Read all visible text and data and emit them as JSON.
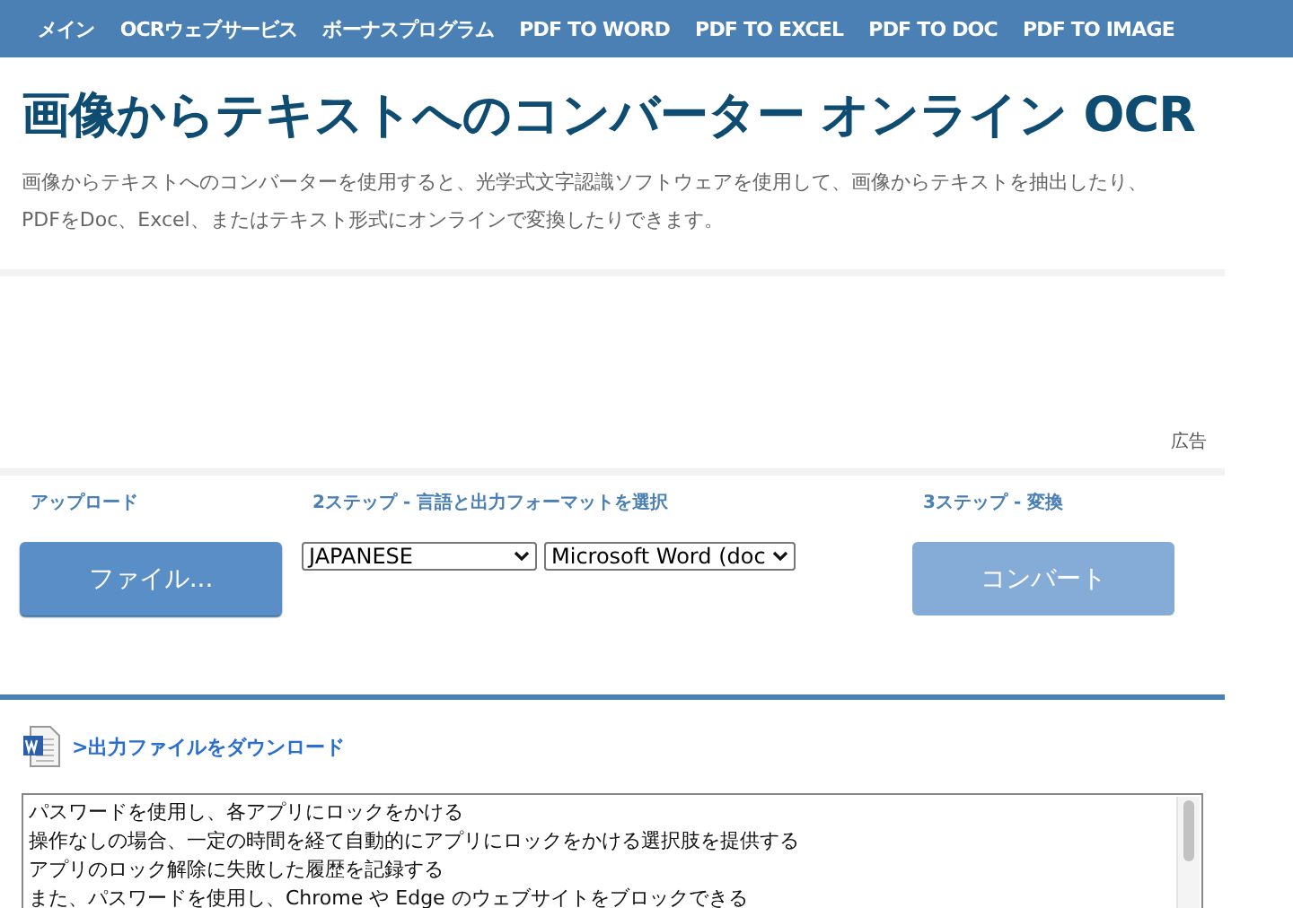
{
  "nav": {
    "items": [
      {
        "label": "メイン"
      },
      {
        "label": "OCRウェブサービス"
      },
      {
        "label": "ボーナスプログラム"
      },
      {
        "label": "PDF TO WORD"
      },
      {
        "label": "PDF TO EXCEL"
      },
      {
        "label": "PDF TO DOC"
      },
      {
        "label": "PDF TO IMAGE"
      }
    ]
  },
  "header": {
    "title": "画像からテキストへのコンバーター オンライン OCR",
    "description": [
      "画像からテキストへのコンバーターを使用すると、光学式文字認識ソフトウェアを使用して、画像からテキストを抽出したり、",
      "PDFをDoc、Excel、またはテキスト形式にオンラインで変換したりできます。"
    ]
  },
  "ad": {
    "label": "広告"
  },
  "steps": [
    {
      "kind": "upload",
      "heading": "アップロード",
      "button": {
        "label": "ファイル...",
        "disabled": false
      }
    },
    {
      "kind": "select",
      "heading": "2ステップ - 言語と出力フォーマットを選択",
      "selects": [
        {
          "value": "JAPANESE"
        },
        {
          "value": "Microsoft Word (doc"
        }
      ]
    },
    {
      "kind": "convert",
      "heading": "3ステップ - 変換",
      "button": {
        "label": "コンバート",
        "disabled": true
      }
    }
  ],
  "result": {
    "download_link": ">出力ファイルをダウンロード",
    "text_lines": [
      "パスワードを使用し、各アプリにロックをかける",
      "操作なしの場合、一定の時間を経て自動的にアプリにロックをかける選択肢を提供する",
      "アプリのロック解除に失敗した履歴を記録する",
      "また、パスワードを使用し、Chrome や Edge のウェブサイトをブロックできる"
    ]
  }
}
